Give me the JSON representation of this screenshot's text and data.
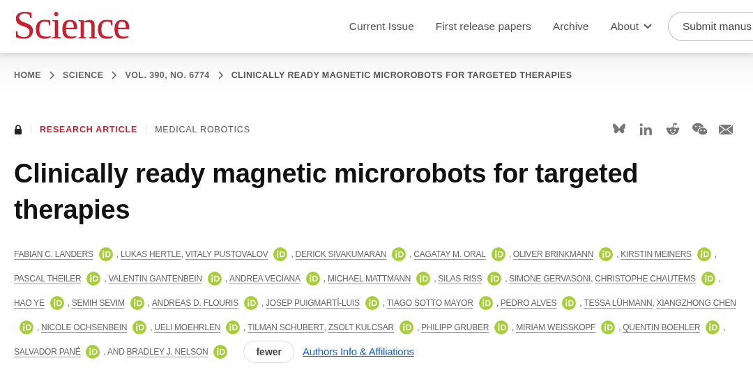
{
  "header": {
    "logo": "Science",
    "nav": [
      {
        "label": "Current Issue",
        "dropdown": false
      },
      {
        "label": "First release papers",
        "dropdown": false
      },
      {
        "label": "Archive",
        "dropdown": false
      },
      {
        "label": "About",
        "dropdown": true
      }
    ],
    "submit_button": "Submit manus"
  },
  "breadcrumb": [
    "HOME",
    "SCIENCE",
    "VOL. 390, NO. 6774",
    "CLINICALLY READY MAGNETIC MICROROBOTS FOR TARGETED THERAPIES"
  ],
  "article": {
    "type": "RESEARCH ARTICLE",
    "section": "MEDICAL ROBOTICS",
    "title": "Clinically ready magnetic microrobots for targeted therapies",
    "author_lines": [
      [
        {
          "kind": "name",
          "text": "FABIAN C. LANDERS"
        },
        {
          "kind": "orcid"
        },
        {
          "kind": "sep",
          "text": ","
        },
        {
          "kind": "name",
          "text": "LUKAS HERTLE"
        },
        {
          "kind": "sep",
          "text": ","
        },
        {
          "kind": "name",
          "text": "VITALY PUSTOVALOV"
        },
        {
          "kind": "orcid"
        },
        {
          "kind": "sep",
          "text": ","
        },
        {
          "kind": "name",
          "text": "DERICK SIVAKUMARAN"
        },
        {
          "kind": "orcid"
        },
        {
          "kind": "sep",
          "text": ","
        },
        {
          "kind": "name",
          "text": "CAGATAY M. ORAL"
        },
        {
          "kind": "orcid"
        },
        {
          "kind": "sep",
          "text": ","
        },
        {
          "kind": "name",
          "text": "OLIVER BRINKMANN"
        },
        {
          "kind": "orcid"
        },
        {
          "kind": "sep",
          "text": ","
        },
        {
          "kind": "name",
          "text": "KIRSTIN MEINERS"
        },
        {
          "kind": "orcid"
        },
        {
          "kind": "sep",
          "text": ","
        }
      ],
      [
        {
          "kind": "name",
          "text": "PASCAL THEILER"
        },
        {
          "kind": "orcid"
        },
        {
          "kind": "sep",
          "text": ","
        },
        {
          "kind": "name",
          "text": "VALENTIN GANTENBEIN"
        },
        {
          "kind": "orcid"
        },
        {
          "kind": "sep",
          "text": ","
        },
        {
          "kind": "name",
          "text": "ANDREA VECIANA"
        },
        {
          "kind": "orcid"
        },
        {
          "kind": "sep",
          "text": ","
        },
        {
          "kind": "name",
          "text": "MICHAEL MATTMANN"
        },
        {
          "kind": "orcid"
        },
        {
          "kind": "sep",
          "text": ","
        },
        {
          "kind": "name",
          "text": "SILAS RISS"
        },
        {
          "kind": "orcid"
        },
        {
          "kind": "sep",
          "text": ","
        },
        {
          "kind": "name",
          "text": "SIMONE GERVASONI"
        },
        {
          "kind": "sep",
          "text": ","
        },
        {
          "kind": "name",
          "text": "CHRISTOPHE CHAUTEMS"
        },
        {
          "kind": "orcid"
        },
        {
          "kind": "sep",
          "text": ","
        }
      ],
      [
        {
          "kind": "name",
          "text": "HAO YE"
        },
        {
          "kind": "orcid"
        },
        {
          "kind": "sep",
          "text": ","
        },
        {
          "kind": "name",
          "text": "SEMIH SEVIM"
        },
        {
          "kind": "orcid"
        },
        {
          "kind": "sep",
          "text": ","
        },
        {
          "kind": "name",
          "text": "ANDREAS D. FLOURIS"
        },
        {
          "kind": "orcid"
        },
        {
          "kind": "sep",
          "text": ","
        },
        {
          "kind": "name",
          "text": "JOSEP PUIGMARTÍ-LUIS"
        },
        {
          "kind": "orcid"
        },
        {
          "kind": "sep",
          "text": ","
        },
        {
          "kind": "name",
          "text": "TIAGO SOTTO MAYOR"
        },
        {
          "kind": "orcid"
        },
        {
          "kind": "sep",
          "text": ","
        },
        {
          "kind": "name",
          "text": "PEDRO ALVES"
        },
        {
          "kind": "orcid"
        },
        {
          "kind": "sep",
          "text": ","
        },
        {
          "kind": "name",
          "text": "TESSA LÜHMANN"
        },
        {
          "kind": "sep",
          "text": ","
        },
        {
          "kind": "name",
          "text": "XIANGZHONG CHEN"
        }
      ],
      [
        {
          "kind": "orcid"
        },
        {
          "kind": "sep",
          "text": ","
        },
        {
          "kind": "name",
          "text": "NICOLE OCHSENBEIN"
        },
        {
          "kind": "orcid"
        },
        {
          "kind": "sep",
          "text": ","
        },
        {
          "kind": "name",
          "text": "UELI MOEHRLEN"
        },
        {
          "kind": "orcid"
        },
        {
          "kind": "sep",
          "text": ","
        },
        {
          "kind": "name",
          "text": "TILMAN SCHUBERT"
        },
        {
          "kind": "sep",
          "text": ","
        },
        {
          "kind": "name",
          "text": "ZSOLT KULCSAR"
        },
        {
          "kind": "orcid"
        },
        {
          "kind": "sep",
          "text": ","
        },
        {
          "kind": "name",
          "text": "PHILIPP GRUBER"
        },
        {
          "kind": "orcid"
        },
        {
          "kind": "sep",
          "text": ","
        },
        {
          "kind": "name",
          "text": "MIRIAM WEISSKOPF"
        },
        {
          "kind": "orcid"
        },
        {
          "kind": "sep",
          "text": ","
        },
        {
          "kind": "name",
          "text": "QUENTIN BOEHLER"
        },
        {
          "kind": "orcid"
        },
        {
          "kind": "sep",
          "text": ","
        }
      ],
      [
        {
          "kind": "name",
          "text": "SALVADOR PANÉ"
        },
        {
          "kind": "orcid"
        },
        {
          "kind": "sep",
          "text": ", AND"
        },
        {
          "kind": "name",
          "text": "BRADLEY J. NELSON"
        },
        {
          "kind": "orcid"
        },
        {
          "kind": "button",
          "text": "fewer"
        },
        {
          "kind": "link",
          "text": "Authors Info & Affiliations"
        }
      ]
    ]
  }
}
